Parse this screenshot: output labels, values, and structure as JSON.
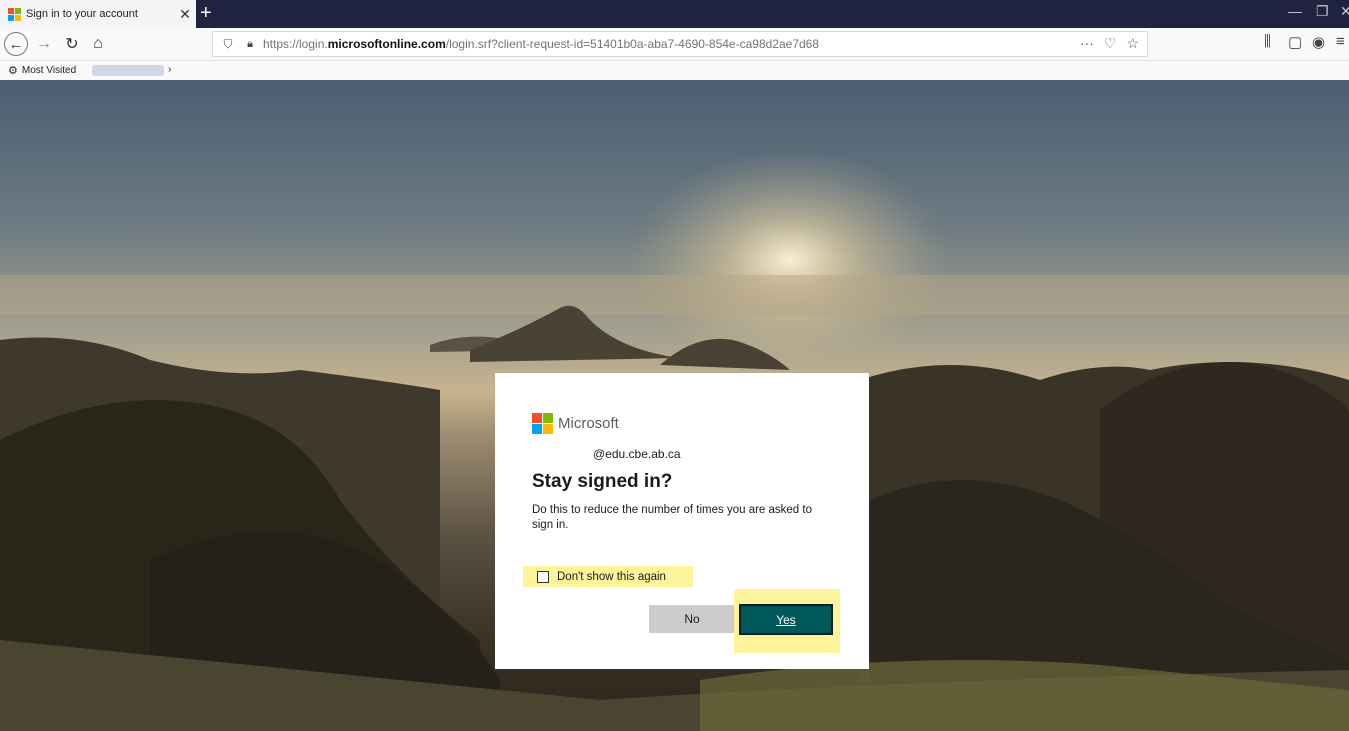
{
  "browser": {
    "tab": {
      "title": "Sign in to your account",
      "close_glyph": "✕"
    },
    "new_tab_glyph": "+",
    "window_controls": {
      "minimize": "—",
      "restore": "❐",
      "close": "✕"
    },
    "nav": {
      "back_glyph": "←",
      "forward_glyph": "→",
      "reload_glyph": "↻",
      "home_glyph": "⌂"
    },
    "url": {
      "prefix": "https://login.",
      "domain": "microsoftonline.com",
      "path": "/login.srf?client-request-id=51401b0a-aba7-4690-854e-ca98d2ae7d68",
      "shield_icon": "shield-icon",
      "lock_icon": "lock-icon",
      "more_glyph": "···",
      "pocket_glyph": "♡",
      "star_glyph": "☆"
    },
    "toolbar_right": {
      "library_glyph": "⫼",
      "sidebar_glyph": "▢",
      "account_glyph": "◉",
      "menu_glyph": "≡"
    },
    "bookmarks": {
      "most_visited": "Most Visited",
      "chevron": "›"
    }
  },
  "dialog": {
    "brand": "Microsoft",
    "brand_colors": [
      "#f25022",
      "#7fba00",
      "#00a4ef",
      "#ffb900"
    ],
    "account_email": "@edu.cbe.ab.ca",
    "title": "Stay signed in?",
    "description": "Do this to reduce the number of times you are asked to sign in.",
    "dont_show_label": "Don't show this again",
    "dont_show_checked": false,
    "no_label": "No",
    "yes_label": "Yes",
    "colors": {
      "yes_bg": "#00585a",
      "no_bg": "#cccccc",
      "highlight": "#fdf39a"
    }
  }
}
